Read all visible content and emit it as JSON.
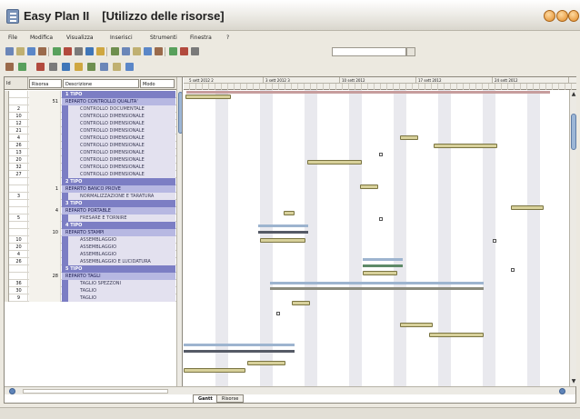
{
  "window": {
    "app_name": "Easy Plan II",
    "subtitle": "[Utilizzo delle risorse]"
  },
  "menu": [
    "File",
    "Modifica",
    "Visualizza",
    "Inserisci",
    "Strumenti",
    "Finestra",
    "?"
  ],
  "toolbar": {
    "search_value": "",
    "icons": [
      "new-icon",
      "open-icon",
      "save-icon",
      "print-icon",
      "preview-icon",
      "cut-icon",
      "copy-icon",
      "paste-icon",
      "undo-icon",
      "redo-icon",
      "link-icon",
      "unlink-icon",
      "indent-icon",
      "outdent-icon",
      "zoom-icon",
      "filter-icon",
      "dropdown-icon"
    ],
    "icons2": [
      "back-icon",
      "forward-icon",
      "find-icon",
      "calendar-icon",
      "resource-icon",
      "task-icon",
      "gantt-icon",
      "chart-icon",
      "report-icon",
      "help-icon"
    ]
  },
  "grid": {
    "headers": [
      "Id",
      "Risorsa",
      "Descrizione",
      "Modo"
    ],
    "rows": [
      {
        "type": "group",
        "num": "",
        "risorsa": "",
        "desc": "1 TIPO"
      },
      {
        "type": "sub",
        "num": "",
        "risorsa": "51",
        "desc": "REPARTO CONTROLLO QUALITA'"
      },
      {
        "type": "task",
        "num": "2",
        "risorsa": "",
        "desc": "CONTROLLO DOCUMENTALE"
      },
      {
        "type": "task",
        "num": "10",
        "risorsa": "",
        "desc": "CONTROLLO DIMENSIONALE"
      },
      {
        "type": "task",
        "num": "12",
        "risorsa": "",
        "desc": "CONTROLLO DIMENSIONALE"
      },
      {
        "type": "task",
        "num": "21",
        "risorsa": "",
        "desc": "CONTROLLO DIMENSIONALE"
      },
      {
        "type": "task",
        "num": "4",
        "risorsa": "",
        "desc": "CONTROLLO DIMENSIONALE"
      },
      {
        "type": "task",
        "num": "26",
        "risorsa": "",
        "desc": "CONTROLLO DIMENSIONALE"
      },
      {
        "type": "task",
        "num": "13",
        "risorsa": "",
        "desc": "CONTROLLO DIMENSIONALE"
      },
      {
        "type": "task",
        "num": "20",
        "risorsa": "",
        "desc": "CONTROLLO DIMENSIONALE"
      },
      {
        "type": "task",
        "num": "32",
        "risorsa": "",
        "desc": "CONTROLLO DIMENSIONALE"
      },
      {
        "type": "task",
        "num": "27",
        "risorsa": "",
        "desc": "CONTROLLO DIMENSIONALE"
      },
      {
        "type": "group",
        "num": "",
        "risorsa": "",
        "desc": "2 TIPO"
      },
      {
        "type": "sub",
        "num": "",
        "risorsa": "1",
        "desc": "REPARTO BANCO PROVE"
      },
      {
        "type": "task",
        "num": "3",
        "risorsa": "",
        "desc": "NORMALIZZAZIONE E TARATURA"
      },
      {
        "type": "group",
        "num": "",
        "risorsa": "",
        "desc": "3 TIPO"
      },
      {
        "type": "sub",
        "num": "",
        "risorsa": "4",
        "desc": "REPARTO PORTABLE"
      },
      {
        "type": "task",
        "num": "5",
        "risorsa": "",
        "desc": "FRESARE E TORNIRE"
      },
      {
        "type": "group",
        "num": "",
        "risorsa": "",
        "desc": "4 TIPO"
      },
      {
        "type": "sub",
        "num": "",
        "risorsa": "10",
        "desc": "REPARTO STAMPI"
      },
      {
        "type": "task",
        "num": "10",
        "risorsa": "",
        "desc": "ASSEMBLAGGIO"
      },
      {
        "type": "task",
        "num": "20",
        "risorsa": "",
        "desc": "ASSEMBLAGGIO"
      },
      {
        "type": "task",
        "num": "4",
        "risorsa": "",
        "desc": "ASSEMBLAGGIO"
      },
      {
        "type": "task",
        "num": "26",
        "risorsa": "",
        "desc": "ASSEMBLAGGIO E LUCIDATURA"
      },
      {
        "type": "group",
        "num": "",
        "risorsa": "",
        "desc": "5 TIPO"
      },
      {
        "type": "sub",
        "num": "",
        "risorsa": "28",
        "desc": "REPARTO TAGLI"
      },
      {
        "type": "task",
        "num": "36",
        "risorsa": "",
        "desc": "TAGLIO SPEZZONI"
      },
      {
        "type": "task",
        "num": "30",
        "risorsa": "",
        "desc": "TAGLIO"
      },
      {
        "type": "task",
        "num": "9",
        "risorsa": "",
        "desc": "TAGLIO"
      }
    ]
  },
  "gantt": {
    "weeks": [
      "5 sett 2012 2",
      "3 sett 2012 3",
      "10 sett 2012",
      "17 sett 2012",
      "24 sett 2012"
    ],
    "tabs": [
      "Gantt",
      "Risorse"
    ]
  }
}
